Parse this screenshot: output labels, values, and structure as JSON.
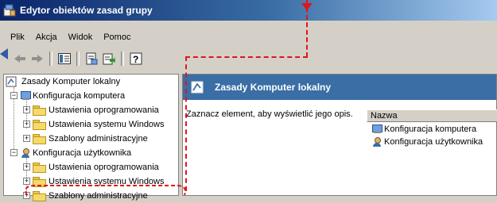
{
  "window": {
    "title": "Edytor obiektów zasad grupy"
  },
  "menu": [
    "Plik",
    "Akcja",
    "Widok",
    "Pomoc"
  ],
  "toolbar": [
    "back-icon",
    "forward-icon",
    "show-hide-tree-icon",
    "properties-icon",
    "export-list-icon",
    "help-icon"
  ],
  "tree": {
    "root": "Zasady Komputer lokalny",
    "computer": "Konfiguracja komputera",
    "computer_children": [
      "Ustawienia oprogramowania",
      "Ustawienia systemu Windows",
      "Szablony administracyjne"
    ],
    "user": "Konfiguracja użytkownika",
    "user_children": [
      "Ustawienia oprogramowania",
      "Ustawienia systemu Windows",
      "Szablony administracyjne"
    ]
  },
  "right_pane": {
    "header": "Zasady Komputer lokalny",
    "description": "Zaznacz element, aby wyświetlić jego opis.",
    "column": "Nazwa",
    "items": [
      "Konfiguracja komputera",
      "Konfiguracja użytkownika"
    ]
  },
  "colors": {
    "annotation": "#e0141c",
    "header_blue": "#3a6ea5",
    "titlebar": "#0a246a"
  }
}
